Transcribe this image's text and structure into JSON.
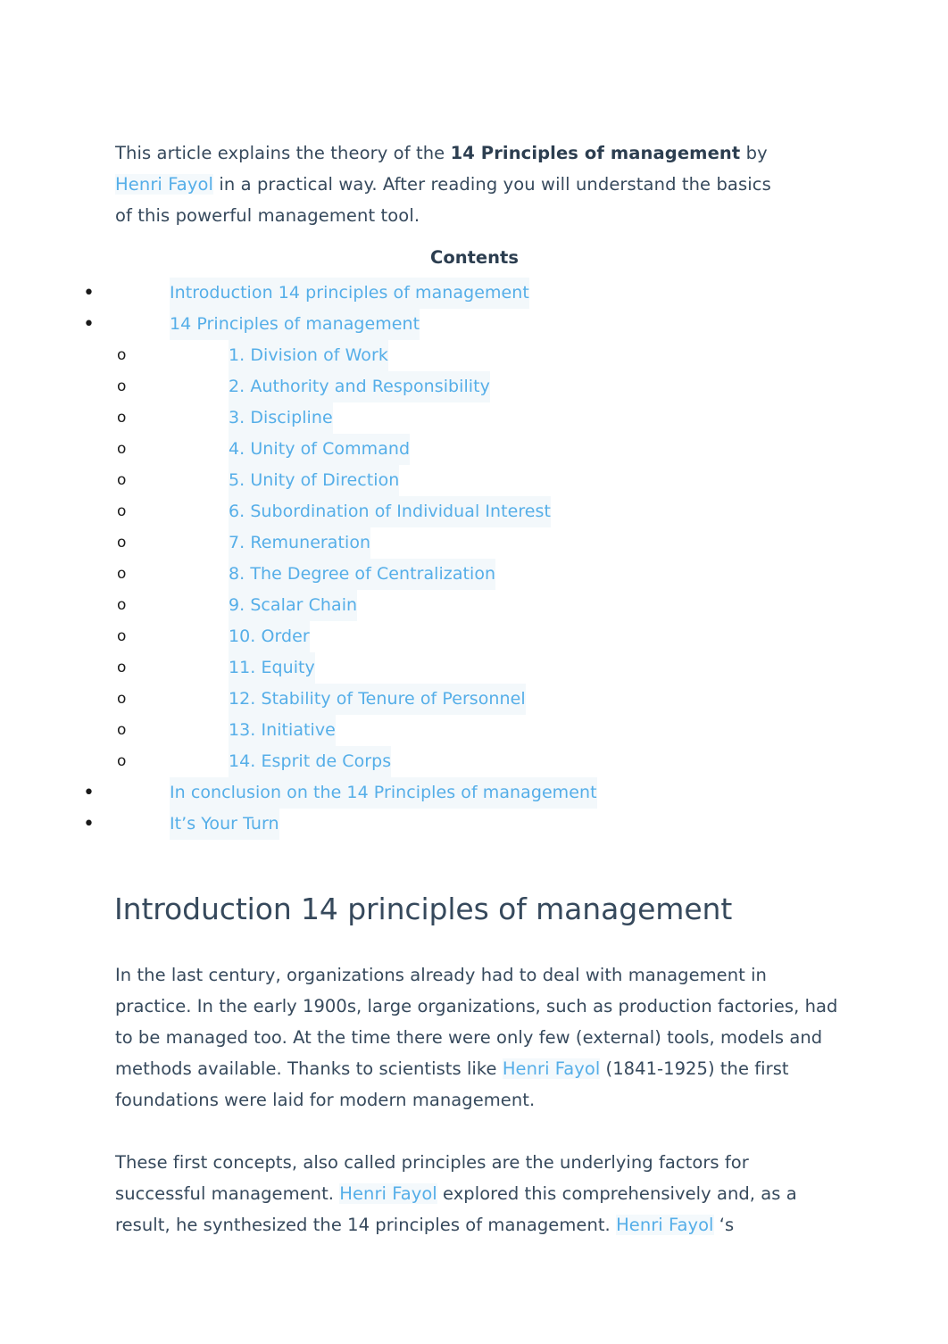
{
  "document": {
    "intro": {
      "seg_1": "This article explains the theory of the ",
      "bold_1": "14 Principles of management",
      "seg_2": " by ",
      "link_1": "Henri Fayol",
      "seg_3": " in a practical way. After reading you will understand the basics of this powerful management tool."
    },
    "contents": {
      "title": "Contents",
      "items": [
        {
          "level": 1,
          "marker": "•",
          "label": "Introduction 14 principles of management"
        },
        {
          "level": 1,
          "marker": "•",
          "label": "14 Principles of management"
        },
        {
          "level": 2,
          "marker": "o",
          "label": "1. Division of Work"
        },
        {
          "level": 2,
          "marker": "o",
          "label": "2. Authority and Responsibility"
        },
        {
          "level": 2,
          "marker": "o",
          "label": "3. Discipline"
        },
        {
          "level": 2,
          "marker": "o",
          "label": "4. Unity of Command"
        },
        {
          "level": 2,
          "marker": "o",
          "label": "5. Unity of Direction"
        },
        {
          "level": 2,
          "marker": "o",
          "label": "6. Subordination of Individual Interest"
        },
        {
          "level": 2,
          "marker": "o",
          "label": "7. Remuneration"
        },
        {
          "level": 2,
          "marker": "o",
          "label": "8. The Degree of Centralization"
        },
        {
          "level": 2,
          "marker": "o",
          "label": "9. Scalar Chain"
        },
        {
          "level": 2,
          "marker": "o",
          "label": "10. Order"
        },
        {
          "level": 2,
          "marker": "o",
          "label": "11. Equity"
        },
        {
          "level": 2,
          "marker": "o",
          "label": "12. Stability of Tenure of Personnel"
        },
        {
          "level": 2,
          "marker": "o",
          "label": "13. Initiative"
        },
        {
          "level": 2,
          "marker": "o",
          "label": "14. Esprit de Corps"
        },
        {
          "level": 1,
          "marker": "•",
          "label": "In conclusion on the 14 Principles of management"
        },
        {
          "level": 1,
          "marker": "•",
          "label": "It’s Your Turn"
        }
      ]
    },
    "section_heading": "Introduction 14 principles of management",
    "paragraph_1": {
      "seg_1": "In the last century, organizations already had to deal with management in practice. In the early 1900s, large organizations, such as production factories, had to be managed too. At the time there were only few (external) tools, models and methods available. Thanks to scientists like ",
      "link_1": "Henri Fayol",
      "seg_2": " (1841-1925) the first foundations were laid for modern management."
    },
    "paragraph_2": {
      "seg_1": "These first concepts, also called principles are the underlying factors for successful management. ",
      "link_1": "Henri Fayol",
      "seg_2": " explored this comprehensively and, as a result, he synthesized the 14 principles of management. ",
      "link_2": "Henri Fayol",
      "seg_3": " ‘s"
    }
  },
  "colors": {
    "body_text": "#36495c",
    "link": "#55aee8",
    "heading": "#2c3e50",
    "background": "#ffffff",
    "link_highlight": "#f3f8fb"
  }
}
